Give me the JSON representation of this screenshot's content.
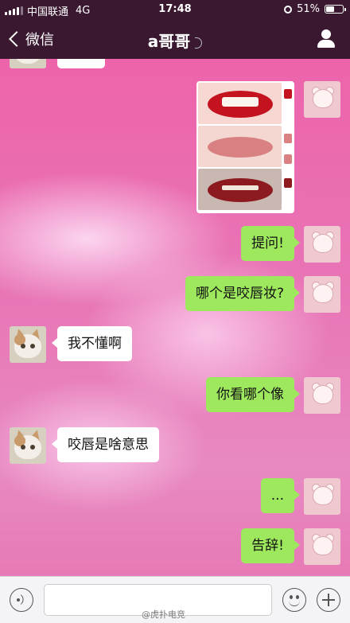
{
  "status_bar": {
    "carrier": "中国联通",
    "network": "4G",
    "time": "17:48",
    "battery_percent": "51%",
    "battery_level": 0.51
  },
  "nav": {
    "back_label": "微信",
    "title": "a哥哥"
  },
  "messages": [
    {
      "from": "me",
      "type": "image"
    },
    {
      "from": "me",
      "text": "提问!"
    },
    {
      "from": "me",
      "text": "哪个是咬唇妆?"
    },
    {
      "from": "them",
      "text": "我不懂啊"
    },
    {
      "from": "me",
      "text": "你看哪个像"
    },
    {
      "from": "them",
      "text": "咬唇是啥意思"
    },
    {
      "from": "me",
      "text": "..."
    },
    {
      "from": "me",
      "text": "告辞!"
    }
  ],
  "watermark": "@虎扑电竞",
  "colors": {
    "my_bubble": "#9ee85e",
    "their_bubble": "#ffffff",
    "top_bar": "#3a1830",
    "background": "#e870b0"
  }
}
